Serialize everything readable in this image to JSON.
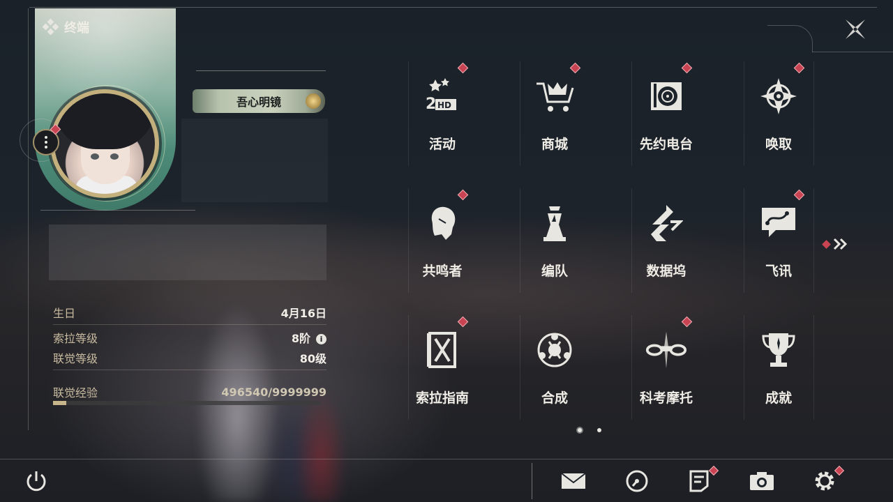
{
  "header": {
    "title": "终端"
  },
  "profile": {
    "title_badge": "吾心明镜",
    "stats": [
      {
        "label": "生日",
        "value": "4月16日"
      },
      {
        "label": "索拉等级",
        "value": "8阶",
        "info_icon": "info-icon"
      },
      {
        "label": "联觉等级",
        "value": "80级"
      }
    ],
    "experience": {
      "label": "联觉经验",
      "value": "496540/9999999",
      "progress_percent": 5
    }
  },
  "menu": {
    "items": [
      {
        "label": "活动",
        "icon": "event-2hd-icon",
        "badge": true
      },
      {
        "label": "商城",
        "icon": "shop-crown-cart-icon",
        "badge": true
      },
      {
        "label": "先约电台",
        "icon": "radio-record-icon",
        "badge": true
      },
      {
        "label": "唤取",
        "icon": "compass-star-icon",
        "badge": true
      },
      {
        "label": "共鸣者",
        "icon": "resonator-portrait-icon",
        "badge": true
      },
      {
        "label": "编队",
        "icon": "team-chess-icon",
        "badge": false
      },
      {
        "label": "数据坞",
        "icon": "data-dock-icon",
        "badge": false
      },
      {
        "label": "飞讯",
        "icon": "message-icon",
        "badge": true
      },
      {
        "label": "索拉指南",
        "icon": "guide-book-icon",
        "badge": true
      },
      {
        "label": "合成",
        "icon": "synthesis-icon",
        "badge": false
      },
      {
        "label": "科考摩托",
        "icon": "motorcycle-icon",
        "badge": true
      },
      {
        "label": "成就",
        "icon": "trophy-icon",
        "badge": false
      }
    ],
    "pages": 2,
    "current_page": 1
  },
  "bottom_bar": {
    "buttons": [
      {
        "name": "mail-button",
        "icon": "mail-icon",
        "badge": false
      },
      {
        "name": "calendar-button",
        "icon": "clock-dial-icon",
        "badge": false
      },
      {
        "name": "notice-button",
        "icon": "notice-icon",
        "badge": true
      },
      {
        "name": "camera-button",
        "icon": "camera-icon",
        "badge": false
      },
      {
        "name": "settings-button",
        "icon": "gear-icon",
        "badge": true
      }
    ]
  },
  "colors": {
    "badge_red": "#c94452",
    "gold": "#c7b58c",
    "text": "#f0ede6"
  }
}
